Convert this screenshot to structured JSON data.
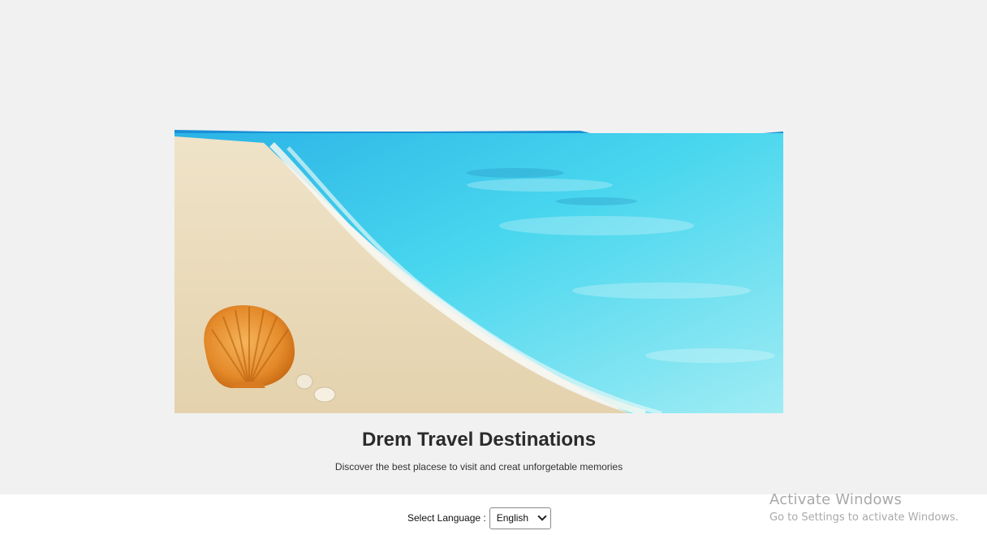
{
  "hero": {
    "title": "Drem Travel Destinations",
    "subtitle": "Discover the best placese to visit and creat unforgetable memories"
  },
  "footer": {
    "language_label": "Select Language :",
    "language_selected": "English"
  },
  "watermark": {
    "title": "Activate Windows",
    "subtitle": "Go to Settings to activate Windows."
  }
}
